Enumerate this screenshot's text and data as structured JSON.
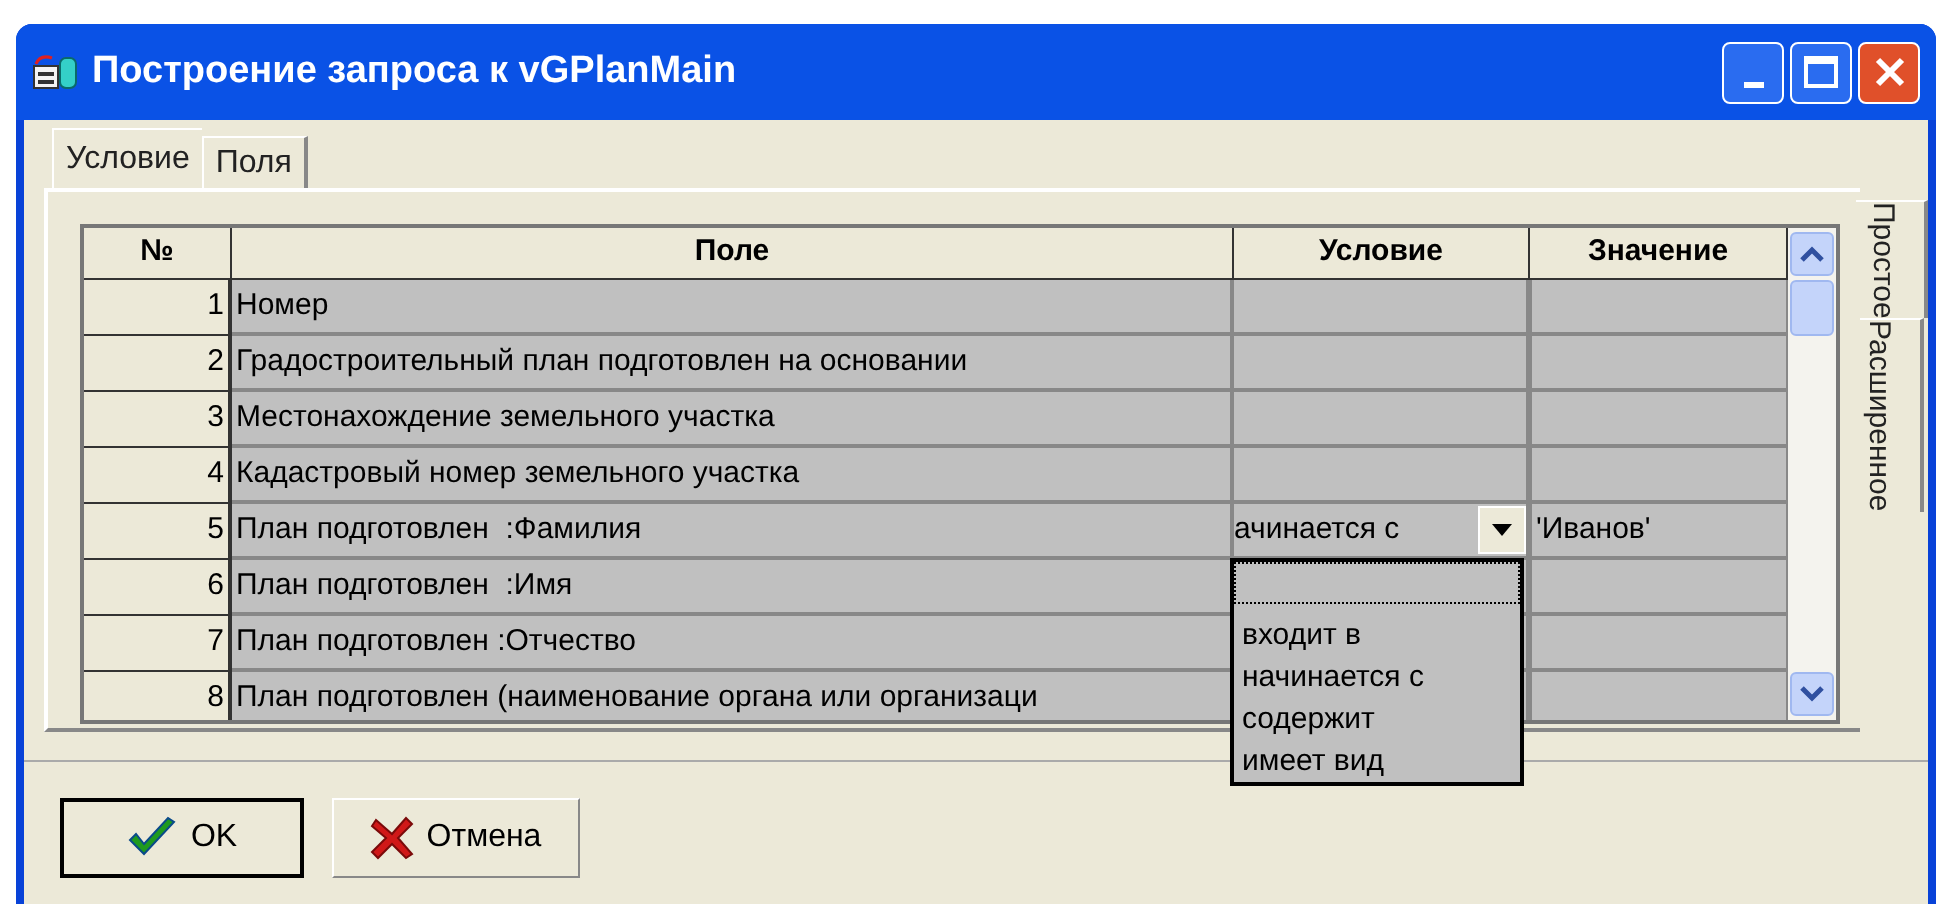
{
  "window": {
    "title": "Построение запроса к vGPlanMain"
  },
  "tabs": [
    {
      "label": "Условие",
      "selected": true
    },
    {
      "label": "Поля",
      "selected": false
    }
  ],
  "side_tabs": [
    {
      "label": "Простое",
      "selected": true
    },
    {
      "label": "Расширенное",
      "selected": false
    }
  ],
  "table": {
    "columns": [
      "№",
      "Поле",
      "Условие",
      "Значение"
    ],
    "rows": [
      {
        "num": "1",
        "field": "Номер"
      },
      {
        "num": "2",
        "field": "Градостроительный план подготовлен на основании"
      },
      {
        "num": "3",
        "field": "Местонахождение земельного участка"
      },
      {
        "num": "4",
        "field": "Кадастровый номер земельного участка"
      },
      {
        "num": "5",
        "field": "План подготовлен  :Фамилия",
        "condition": "ачинается с",
        "value": "'Иванов'"
      },
      {
        "num": "6",
        "field": "План подготовлен  :Имя"
      },
      {
        "num": "7",
        "field": "План подготовлен :Отчество"
      },
      {
        "num": "8",
        "field": "План подготовлен (наименование органа или организаци"
      }
    ]
  },
  "dropdown": {
    "options": [
      {
        "selected": true
      },
      {
        "label": "входит в",
        "selected": false
      },
      {
        "label": "начинается с",
        "selected": false
      },
      {
        "label": "содержит",
        "selected": false
      },
      {
        "label": "имеет вид",
        "selected": false
      }
    ]
  },
  "buttons": [
    {
      "label": "OK",
      "kind": "ok"
    },
    {
      "label": "Отмена",
      "kind": "cancel"
    }
  ]
}
